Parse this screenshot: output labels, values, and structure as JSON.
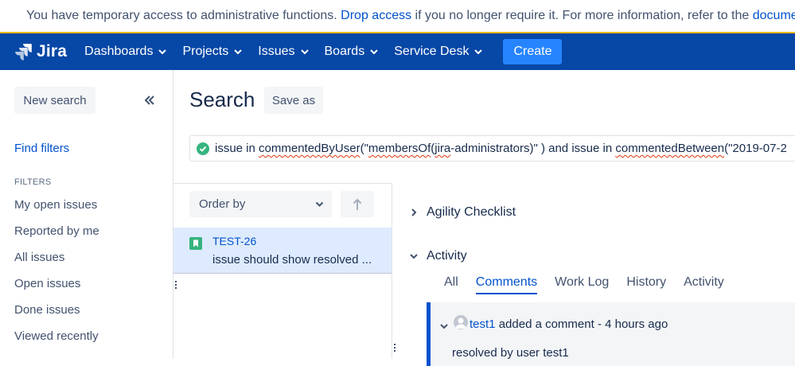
{
  "banner": {
    "text_before": "You have temporary access to administrative functions.",
    "link_drop": "Drop access",
    "text_middle": "if you no longer require it. For more information, refer to the",
    "link_docs": "documentation"
  },
  "nav": {
    "logo": "Jira",
    "items": [
      {
        "label": "Dashboards"
      },
      {
        "label": "Projects"
      },
      {
        "label": "Issues"
      },
      {
        "label": "Boards"
      },
      {
        "label": "Service Desk"
      }
    ],
    "create": "Create"
  },
  "sidebar": {
    "new_search": "New search",
    "find_filters": "Find filters",
    "filters_heading": "FILTERS",
    "filters": [
      {
        "label": "My open issues"
      },
      {
        "label": "Reported by me"
      },
      {
        "label": "All issues"
      },
      {
        "label": "Open issues"
      },
      {
        "label": "Done issues"
      },
      {
        "label": "Viewed recently"
      }
    ]
  },
  "search": {
    "title": "Search",
    "save_as": "Save as",
    "jql": {
      "p1": "issue in ",
      "p2": "commentedByUser",
      "p3": "(\"",
      "p4": "membersOf",
      "p5": "(",
      "p6": "jira",
      "p7": "-administrators)\" ) and issue in ",
      "p8": "commentedBetween",
      "p9": "(\"2019-07-2"
    }
  },
  "list": {
    "order_by": "Order by",
    "issues": [
      {
        "key": "TEST-26",
        "summary": "issue should show resolved ..."
      }
    ]
  },
  "detail": {
    "agility": "Agility Checklist",
    "activity": "Activity",
    "tabs": [
      {
        "label": "All"
      },
      {
        "label": "Comments"
      },
      {
        "label": "Work Log"
      },
      {
        "label": "History"
      },
      {
        "label": "Activity"
      }
    ],
    "active_tab": "Comments",
    "comment": {
      "author": "test1",
      "action": "added a comment - 4 hours ago",
      "body": "resolved by user test1"
    }
  },
  "colors": {
    "nav_bg": "#0747a6",
    "create_bg": "#2684ff",
    "link": "#0052cc",
    "warning": "#f5b70a",
    "selected_row": "#deebff"
  }
}
